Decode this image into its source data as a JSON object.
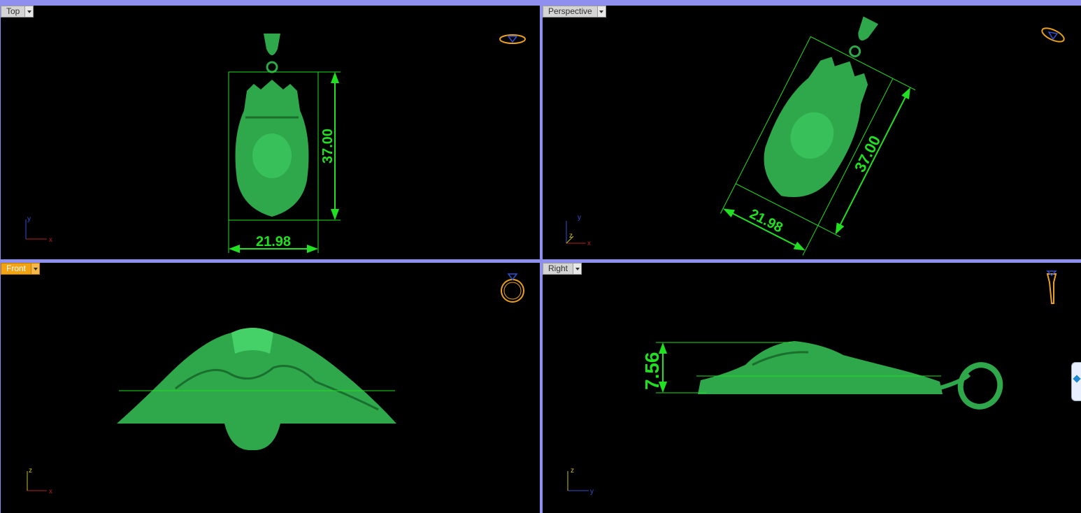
{
  "viewports": {
    "top": {
      "name": "Top",
      "active": false,
      "width_dim": "21.98",
      "height_dim": "37.00",
      "axes": [
        "y",
        "x"
      ]
    },
    "perspective": {
      "name": "Perspective",
      "active": false,
      "width_dim": "21.98",
      "height_dim": "37.00",
      "axes": [
        "y",
        "z",
        "x"
      ]
    },
    "front": {
      "name": "Front",
      "active": true,
      "axes": [
        "z",
        "x"
      ]
    },
    "right": {
      "name": "Right",
      "active": false,
      "depth_dim": "7.56",
      "axes": [
        "z",
        "y"
      ]
    }
  },
  "colors": {
    "background": "#000000",
    "model": "#2ea84a",
    "dimension": "#21e021",
    "active_tab": "#f2a314",
    "frame": "#8f8ff0",
    "axis_x": "#b02020",
    "axis_y": "#3050d0",
    "axis_z": "#c8c020",
    "gizmo": "#e8a020"
  },
  "icons": {
    "view_gizmos": [
      "ring-top-view-icon",
      "ring-perspective-icon",
      "ring-front-view-icon",
      "ring-side-view-icon"
    ],
    "side_panel": "panel-expand-icon"
  }
}
